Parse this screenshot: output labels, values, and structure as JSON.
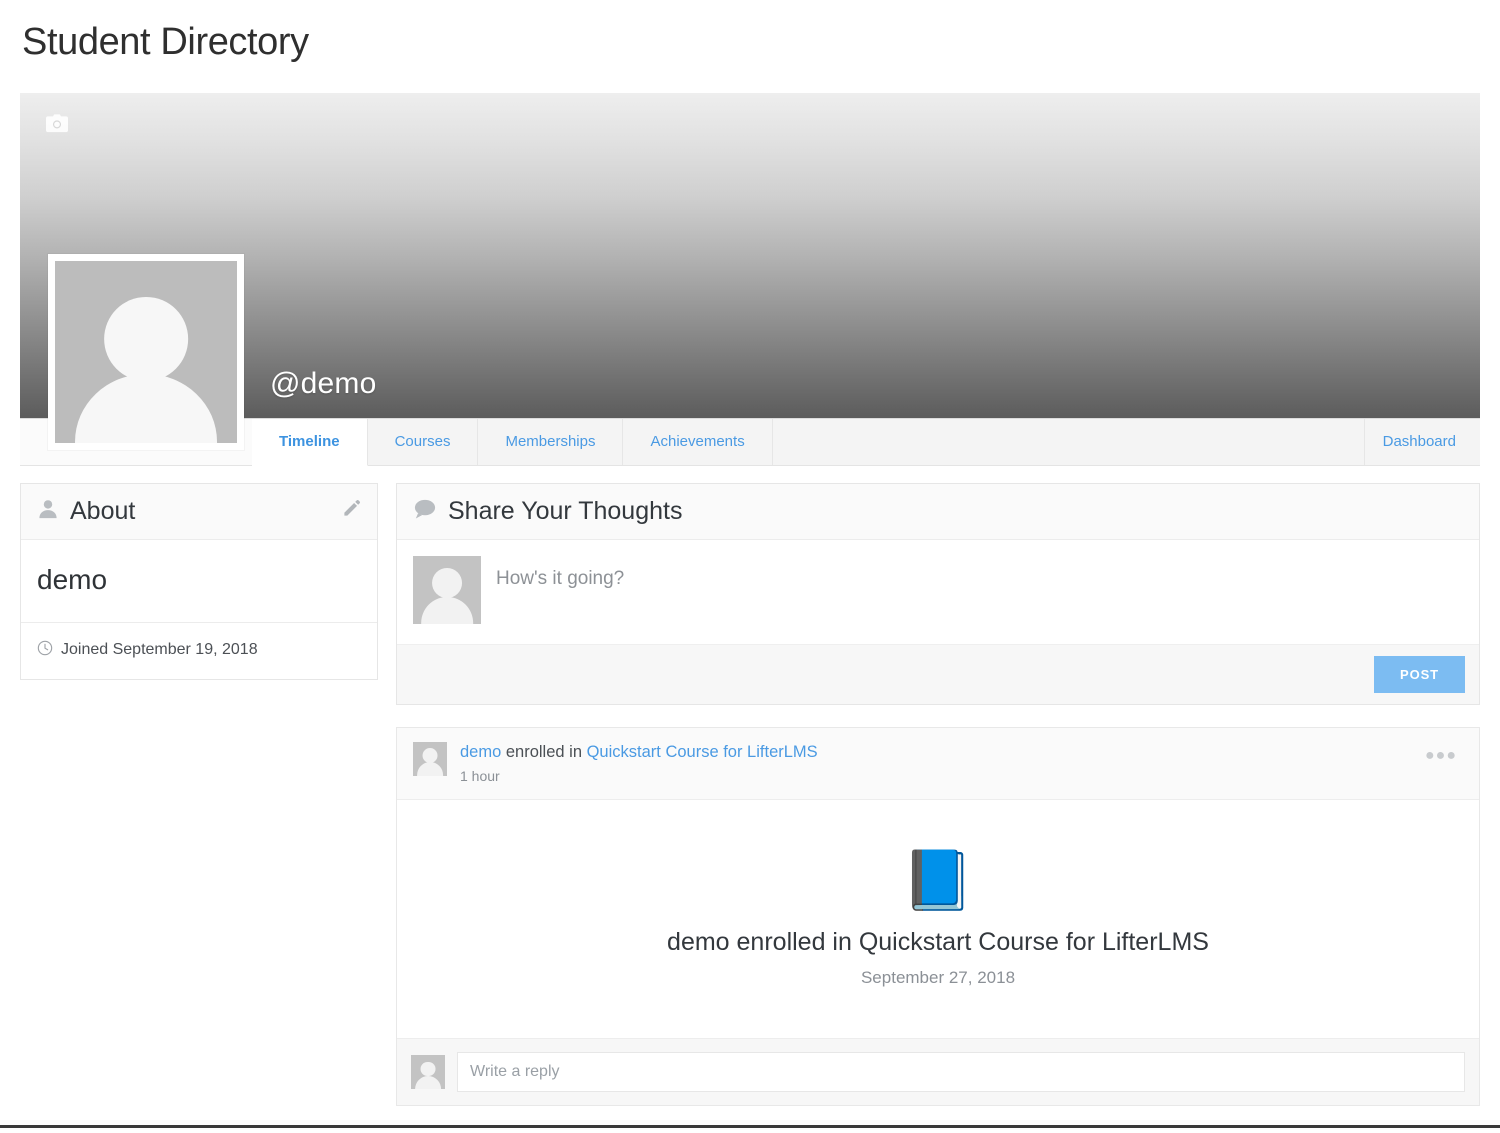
{
  "page": {
    "title": "Student Directory"
  },
  "profile": {
    "cover_camera_icon": "camera-icon",
    "username": "@demo",
    "avatar_icon": "default-user-avatar",
    "cover_gradient_top": "#eeeeee",
    "cover_gradient_bottom": "#5c5c5c"
  },
  "nav": {
    "tabs": [
      {
        "label": "Timeline",
        "active": true
      },
      {
        "label": "Courses",
        "active": false
      },
      {
        "label": "Memberships",
        "active": false
      },
      {
        "label": "Achievements",
        "active": false
      }
    ],
    "right_link": "Dashboard",
    "link_color": "#4a9ae3"
  },
  "about": {
    "heading": "About",
    "heading_icon": "user-icon",
    "edit_icon": "pencil-icon",
    "name": "demo",
    "joined_icon": "clock-icon",
    "joined": "Joined September 19, 2018"
  },
  "share": {
    "heading": "Share Your Thoughts",
    "heading_icon": "comment-bubble-icon",
    "placeholder": "How's it going?",
    "post_label": "POST",
    "post_button_color": "#7cbcf2"
  },
  "activity": {
    "actor": "demo",
    "action_text": " enrolled in ",
    "object": "Quickstart Course for LifterLMS",
    "time": "1 hour",
    "menu_icon": "ellipsis-icon",
    "content_icon": "blue-book-icon",
    "content_icon_glyph": "📘",
    "content_title": "demo enrolled in Quickstart Course for LifterLMS",
    "content_date": "September 27, 2018",
    "reply_placeholder": "Write a reply"
  }
}
